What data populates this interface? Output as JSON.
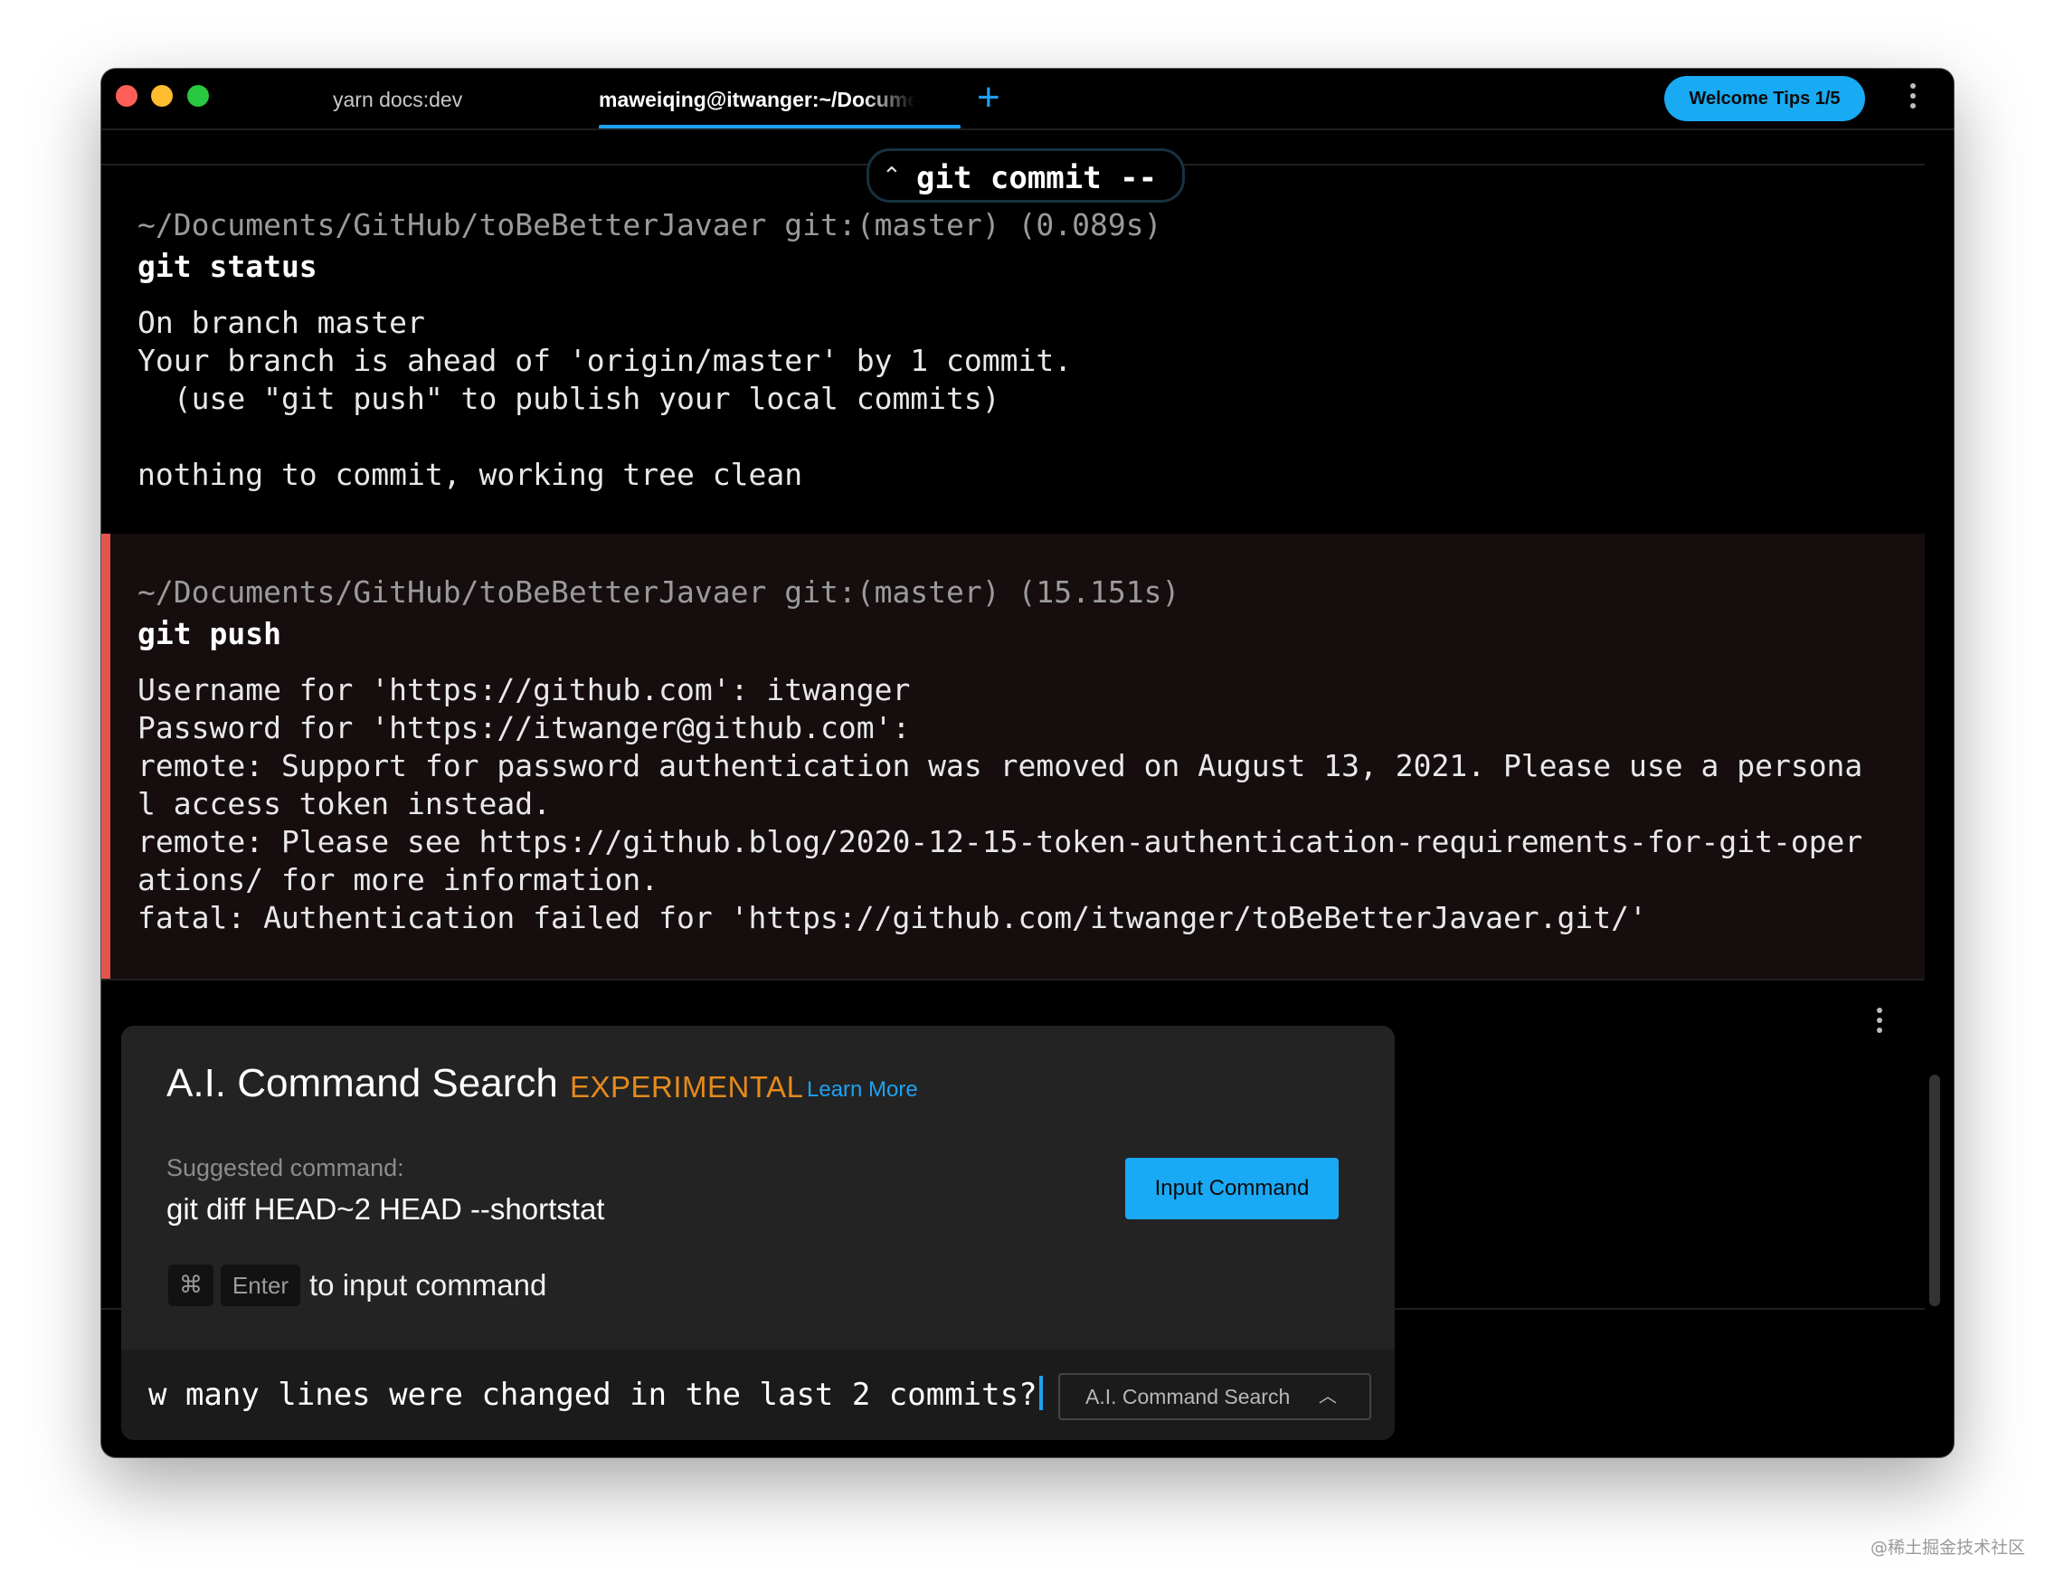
{
  "tabs": [
    {
      "label": "yarn docs:dev",
      "active": false
    },
    {
      "label": "maweiqing@itwanger:~/Documents/GitHub/toBeBetterJavaer",
      "active": true
    }
  ],
  "header": {
    "new_tab_icon": "plus",
    "welcome_label": "Welcome Tips 1/5",
    "menu_icon": "vertical-ellipsis"
  },
  "colors": {
    "accent": "#1da1f2",
    "error_bar": "#e2544d",
    "experimental": "#e48a1d"
  },
  "sticky_header": {
    "icon": "double-chevron-up",
    "text": "git commit --"
  },
  "blocks": [
    {
      "prompt": "~/Documents/GitHub/toBeBetterJavaer git:(master) (0.089s)",
      "command": "git status",
      "output": [
        "On branch master",
        "Your branch is ahead of 'origin/master' by 1 commit.",
        "  (use \"git push\" to publish your local commits)",
        "nothing to commit, working tree clean"
      ]
    },
    {
      "prompt": "~/Documents/GitHub/toBeBetterJavaer git:(master) (15.151s)",
      "command": "git push",
      "status": "error",
      "output": [
        "Username for 'https://github.com': itwanger",
        "Password for 'https://itwanger@github.com':",
        "remote: Support for password authentication was removed on August 13, 2021. Please use a persona",
        "l access token instead.",
        "remote: Please see https://github.blog/2020-12-15-token-authentication-requirements-for-git-oper",
        "ations/ for more information.",
        "fatal: Authentication failed for 'https://github.com/itwanger/toBeBetterJavaer.git/'"
      ]
    }
  ],
  "ai_search": {
    "title": "A.I. Command Search",
    "badge": "EXPERIMENTAL",
    "learn_more": "Learn More",
    "suggested_label": "Suggested command:",
    "suggested_command": "git diff HEAD~2 HEAD --shortstat",
    "input_button": "Input Command",
    "shortcut_cmd": "⌘",
    "shortcut_enter": "Enter",
    "shortcut_hint": "to input command",
    "query": "w many lines were changed in the last 2 commits?",
    "mode_label": "A.I. Command Search",
    "mode_icon": "chevron-up"
  },
  "watermark": "@稀土掘金技术社区"
}
